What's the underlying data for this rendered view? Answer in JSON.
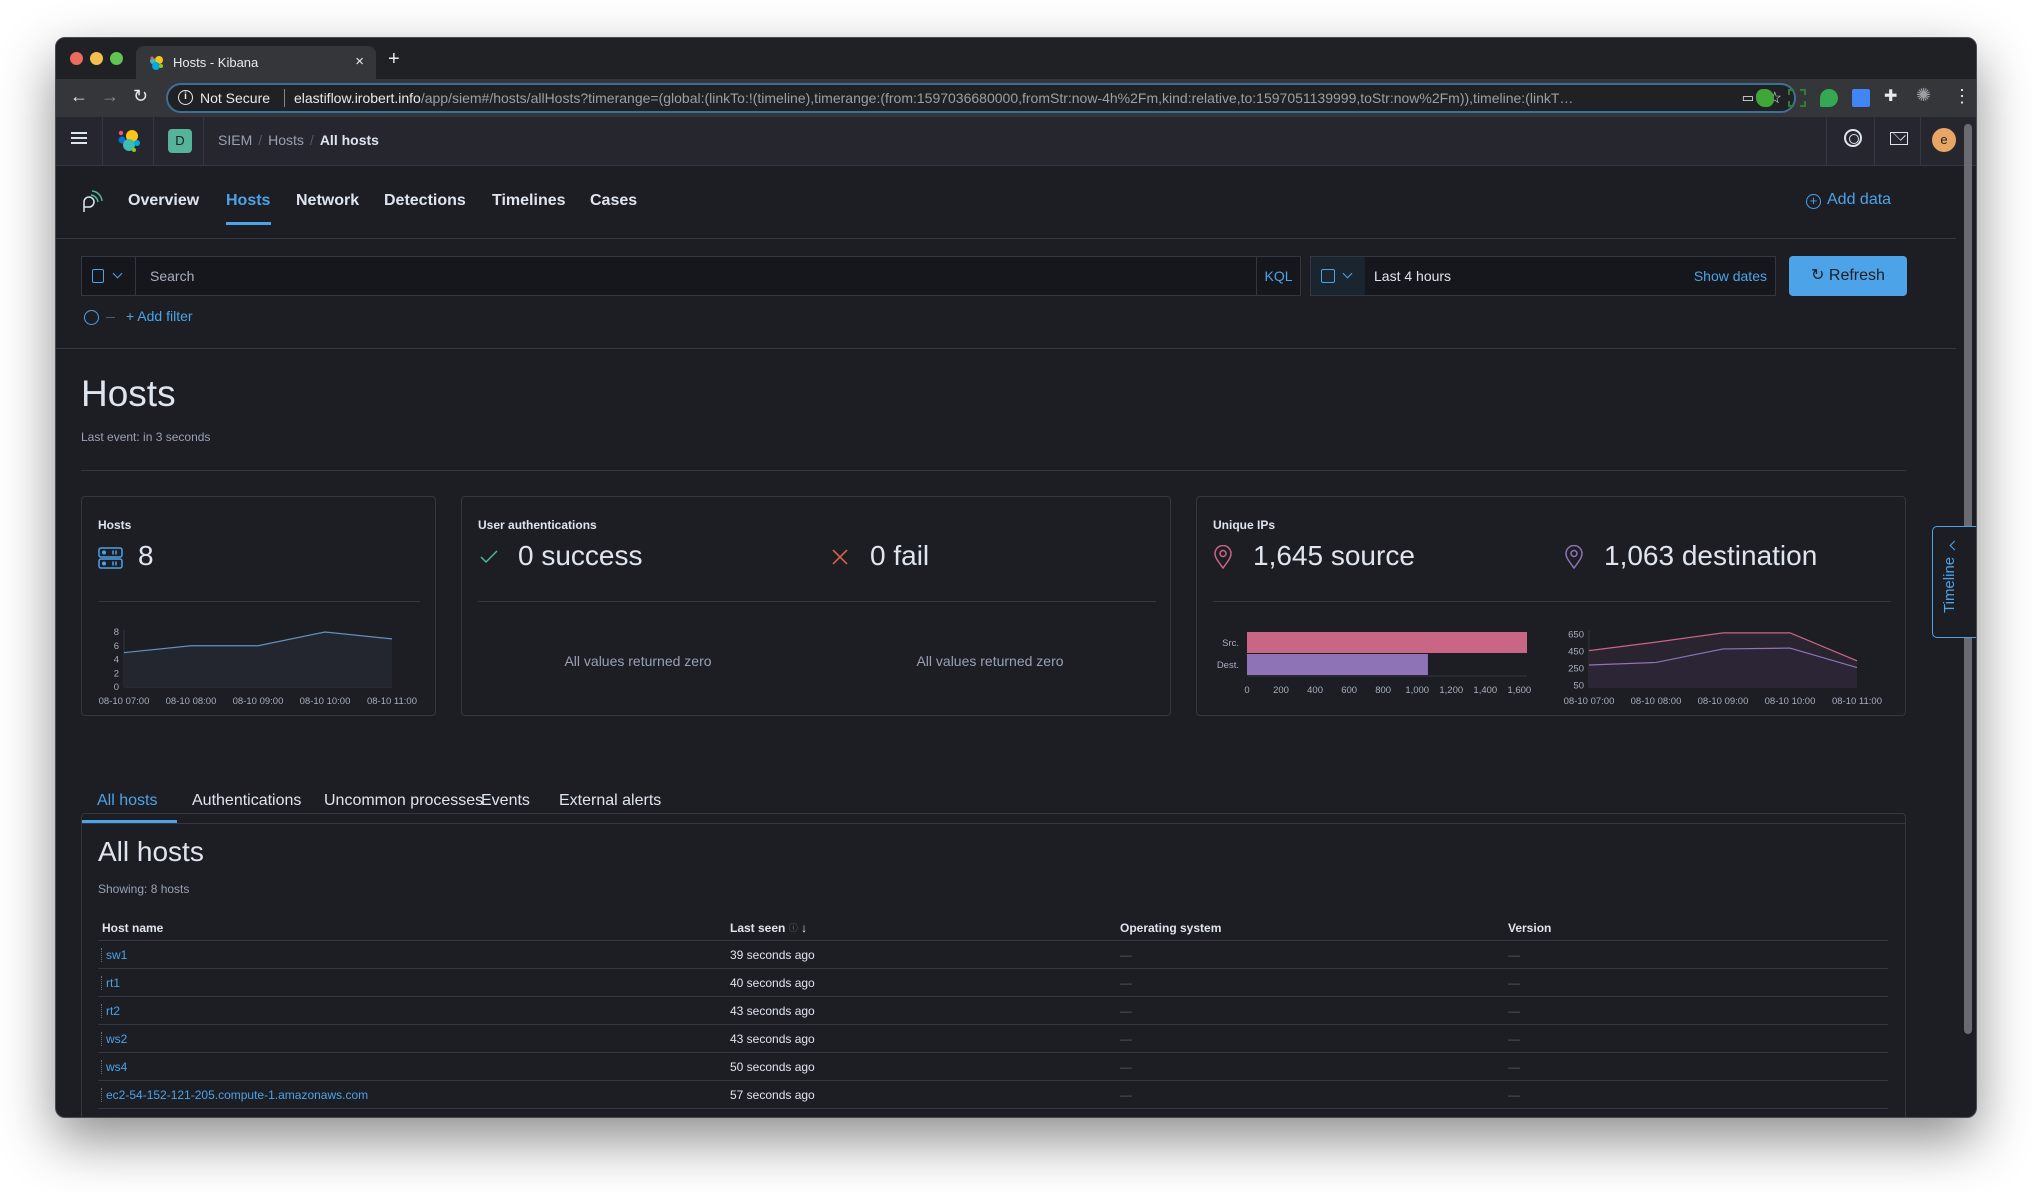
{
  "browser": {
    "tab_title": "Hosts - Kibana",
    "tab_close": "×",
    "new_tab": "+",
    "security_label": "Not Secure",
    "url_host": "elastiflow.irobert.info",
    "url_path": "/app/siem#/hosts/allHosts?timerange=(global:(linkTo:!(timeline),timerange:(from:1597036680000,fromStr:now-4h%2Fm,kind:relative,to:1597051139999,toStr:now%2Fm)),timeline:(linkT…",
    "extensions": [
      "evernote-icon",
      "screen-capture-icon",
      "hangouts-icon",
      "google-translate-icon",
      "extensions-puzzle-icon",
      "pinwheel-icon"
    ]
  },
  "header": {
    "space_initial": "D",
    "breadcrumbs": [
      "SIEM",
      "Hosts",
      "All hosts"
    ],
    "avatar_initial": "e"
  },
  "siem_nav": {
    "tabs": [
      {
        "label": "Overview",
        "active": false
      },
      {
        "label": "Hosts",
        "active": true
      },
      {
        "label": "Network",
        "active": false
      },
      {
        "label": "Detections",
        "active": false
      },
      {
        "label": "Timelines",
        "active": false
      },
      {
        "label": "Cases",
        "active": false
      }
    ],
    "add_data": "Add data"
  },
  "query_bar": {
    "search_placeholder": "Search",
    "search_value": "",
    "language": "KQL",
    "date_range": "Last 4 hours",
    "show_dates": "Show dates",
    "refresh": "Refresh",
    "add_filter": "+ Add filter"
  },
  "page": {
    "title": "Hosts",
    "last_event": "Last event: in 3 seconds"
  },
  "stats": {
    "hosts": {
      "title": "Hosts",
      "value": "8"
    },
    "user_auth": {
      "title": "User authentications",
      "success": "0 success",
      "fail": "0 fail",
      "success_empty": "All values returned zero",
      "fail_empty": "All values returned zero"
    },
    "unique_ips": {
      "title": "Unique IPs",
      "source": "1,645 source",
      "destination": "1,063 destination"
    }
  },
  "colors": {
    "accent": "#4ca3e8",
    "source": "#c96685",
    "destination": "#8e74b6",
    "success": "#54b399",
    "fail": "#e7664c"
  },
  "chart_data": [
    {
      "type": "area",
      "title": "Hosts",
      "x": [
        "08-10 07:00",
        "08-10 08:00",
        "08-10 09:00",
        "08-10 10:00",
        "08-10 11:00"
      ],
      "series": [
        {
          "name": "Hosts",
          "values": [
            5,
            6,
            6,
            8,
            7
          ]
        }
      ],
      "yticks": [
        0,
        2,
        4,
        6,
        8
      ],
      "ylim": [
        0,
        8
      ],
      "grid": false
    },
    {
      "type": "bar",
      "orientation": "horizontal",
      "title": "Unique IPs",
      "categories": [
        "Src.",
        "Dest."
      ],
      "values": [
        1645,
        1063
      ],
      "xticks": [
        0,
        200,
        400,
        600,
        800,
        1000,
        1200,
        1400,
        1600
      ],
      "xtick_labels": [
        "0",
        "200",
        "400",
        "600",
        "800",
        "1,000",
        "1,200",
        "1,400",
        "1,600"
      ],
      "xlim": [
        0,
        1645
      ]
    },
    {
      "type": "area",
      "title": "Unique IPs over time",
      "x": [
        "08-10 07:00",
        "08-10 08:00",
        "08-10 09:00",
        "08-10 10:00",
        "08-10 11:00"
      ],
      "series": [
        {
          "name": "Source",
          "values": [
            460,
            560,
            670,
            670,
            340
          ]
        },
        {
          "name": "Destination",
          "values": [
            290,
            320,
            480,
            490,
            260
          ]
        }
      ],
      "yticks": [
        50,
        250,
        450,
        650
      ],
      "ylim": [
        30,
        680
      ],
      "grid": false
    }
  ],
  "subtabs": [
    {
      "label": "All hosts",
      "active": true
    },
    {
      "label": "Authentications",
      "active": false
    },
    {
      "label": "Uncommon processes",
      "active": false
    },
    {
      "label": "Events",
      "active": false
    },
    {
      "label": "External alerts",
      "active": false
    }
  ],
  "table": {
    "title": "All hosts",
    "count": "Showing: 8 hosts",
    "columns": [
      "Host name",
      "Last seen",
      "Operating system",
      "Version"
    ],
    "sort_indicator": "↓",
    "rows": [
      {
        "host": "sw1",
        "last_seen": "39 seconds ago",
        "os": "—",
        "version": "—"
      },
      {
        "host": "rt1",
        "last_seen": "40 seconds ago",
        "os": "—",
        "version": "—"
      },
      {
        "host": "rt2",
        "last_seen": "43 seconds ago",
        "os": "—",
        "version": "—"
      },
      {
        "host": "ws2",
        "last_seen": "43 seconds ago",
        "os": "—",
        "version": "—"
      },
      {
        "host": "ws4",
        "last_seen": "50 seconds ago",
        "os": "—",
        "version": "—"
      },
      {
        "host": "ec2-54-152-121-205.compute-1.amazonaws.com",
        "last_seen": "57 seconds ago",
        "os": "—",
        "version": "—"
      }
    ]
  },
  "timeline_flyout": {
    "label": "Timeline"
  }
}
